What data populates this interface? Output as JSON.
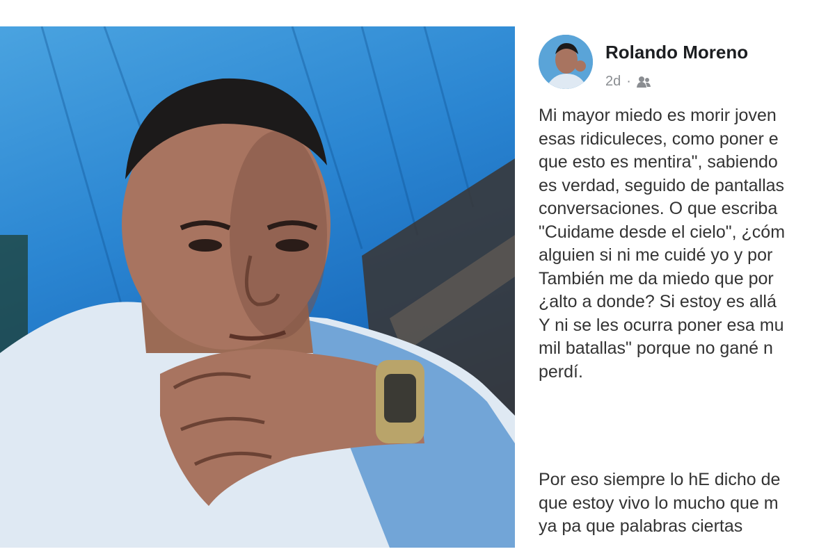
{
  "post": {
    "author": "Rolando Moreno",
    "time": "2d",
    "separator": "·",
    "audience_icon": "friends-icon",
    "paragraph1": [
      "Mi mayor miedo es morir joven",
      "esas ridiculeces, como poner e",
      "que esto es mentira\", sabiendo",
      "es verdad, seguido de pantallas",
      "conversaciones. O que escriba",
      "\"Cuidame desde el cielo\", ¿cóm",
      "alguien si ni me cuidé yo y por",
      "También me da miedo que por",
      "¿alto a donde? Si estoy es allá",
      "Y ni se les ocurra poner esa mu",
      "mil batallas\" porque no gané n",
      "perdí."
    ],
    "paragraph2": [
      "Por eso siempre lo hE dicho de",
      "que estoy vivo lo mucho que m",
      "ya pa que palabras ciertas"
    ]
  },
  "colors": {
    "photo_blue": "#2b86d2",
    "name_text": "#1c1e21",
    "meta_text": "#8a8d91",
    "body_text": "#333333"
  }
}
